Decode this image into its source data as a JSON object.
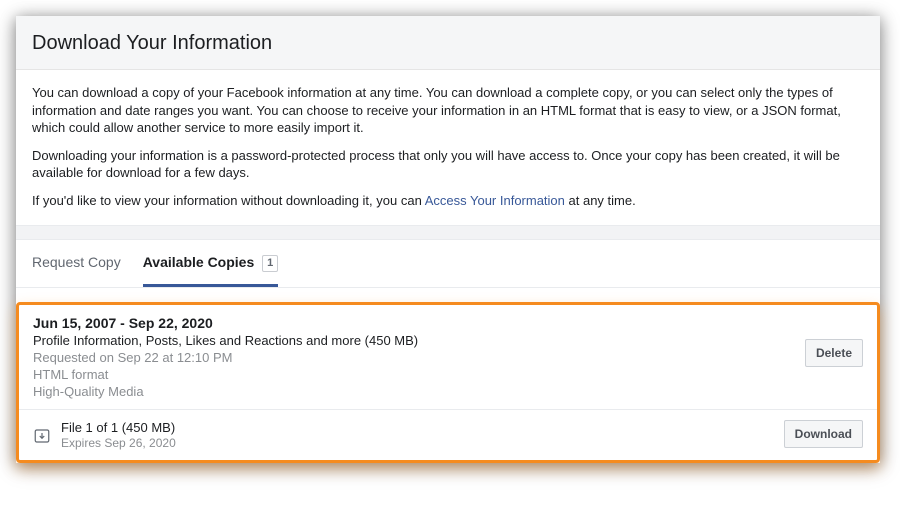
{
  "header": {
    "title": "Download Your Information"
  },
  "description": {
    "p1": "You can download a copy of your Facebook information at any time. You can download a complete copy, or you can select only the types of information and date ranges you want. You can choose to receive your information in an HTML format that is easy to view, or a JSON format, which could allow another service to more easily import it.",
    "p2": "Downloading your information is a password-protected process that only you will have access to. Once your copy has been created, it will be available for download for a few days.",
    "p3_prefix": "If you'd like to view your information without downloading it, you can ",
    "p3_link": "Access Your Information",
    "p3_suffix": " at any time."
  },
  "tabs": {
    "request": "Request Copy",
    "available": "Available Copies",
    "badge": "1"
  },
  "copy": {
    "date_range": "Jun 15, 2007 - Sep 22, 2020",
    "summary": "Profile Information, Posts, Likes and Reactions and more (450 MB)",
    "requested": "Requested on Sep 22 at 12:10 PM",
    "format": "HTML format",
    "quality": "High-Quality Media",
    "delete_label": "Delete"
  },
  "file": {
    "title": "File 1 of 1 (450 MB)",
    "expires": "Expires Sep 26, 2020",
    "download_label": "Download"
  }
}
